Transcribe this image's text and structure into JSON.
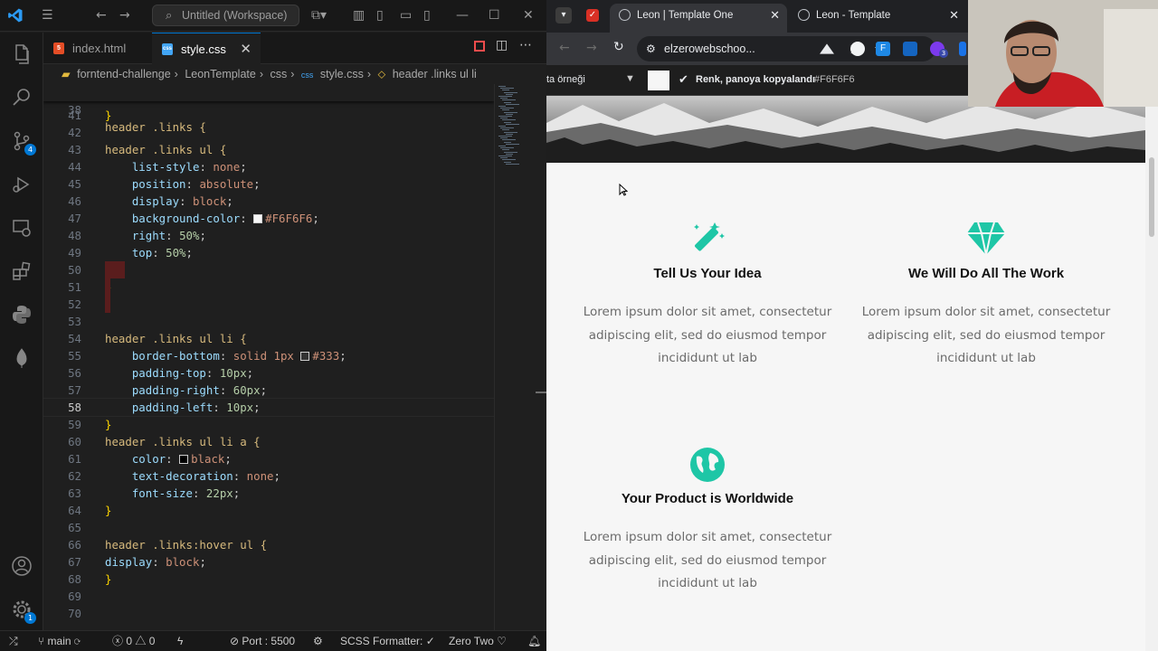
{
  "vscode": {
    "search_text": "Untitled (Workspace)",
    "tabs": [
      {
        "label": "index.html",
        "type": "html"
      },
      {
        "label": "style.css",
        "type": "css"
      }
    ],
    "breadcrumb": [
      "forntend-challenge",
      "LeonTemplate",
      "css",
      "style.css",
      "header .links ul li"
    ],
    "sticky_line": {
      "num": "38",
      "text": "header .links {"
    },
    "badges": {
      "source_control": "4",
      "accounts": "1"
    },
    "lines": [
      {
        "num": "41",
        "text": "}"
      },
      {
        "num": "42",
        "text": ""
      },
      {
        "num": "43",
        "text": "header .links ul {"
      },
      {
        "num": "44",
        "text": "    list-style: none;"
      },
      {
        "num": "45",
        "text": "    position: absolute;"
      },
      {
        "num": "46",
        "text": "    display: block;"
      },
      {
        "num": "47",
        "text": "    background-color: #F6F6F6;"
      },
      {
        "num": "48",
        "text": "    right: 50%;"
      },
      {
        "num": "49",
        "text": "    top: 50%;"
      },
      {
        "num": "50",
        "text": ""
      },
      {
        "num": "51",
        "text": "}"
      },
      {
        "num": "52",
        "text": ""
      },
      {
        "num": "53",
        "text": ""
      },
      {
        "num": "54",
        "text": "header .links ul li {"
      },
      {
        "num": "55",
        "text": "    border-bottom: solid 1px #333;"
      },
      {
        "num": "56",
        "text": "    padding-top: 10px;"
      },
      {
        "num": "57",
        "text": "    padding-right: 60px;"
      },
      {
        "num": "58",
        "text": "    padding-left: 10px;"
      },
      {
        "num": "59",
        "text": "}"
      },
      {
        "num": "60",
        "text": "header .links ul li a {"
      },
      {
        "num": "61",
        "text": "    color: black;"
      },
      {
        "num": "62",
        "text": "    text-decoration: none;"
      },
      {
        "num": "63",
        "text": "    font-size: 22px;"
      },
      {
        "num": "64",
        "text": "}"
      },
      {
        "num": "65",
        "text": ""
      },
      {
        "num": "66",
        "text": "header .links:hover ul {"
      },
      {
        "num": "67",
        "text": "display: block;"
      },
      {
        "num": "68",
        "text": "}"
      },
      {
        "num": "69",
        "text": ""
      },
      {
        "num": "70",
        "text": ""
      }
    ],
    "current_line": "58",
    "status": {
      "branch": "main",
      "errors": "0",
      "warnings": "0",
      "port": "Port : 5500",
      "formatter": "SCSS Formatter: ✓",
      "zero_two": "Zero Two"
    }
  },
  "browser": {
    "tabs": [
      {
        "label": "Leon | Template One",
        "active": true
      },
      {
        "label": "Leon - Template",
        "active": false
      }
    ],
    "url": "elzerowebschoo...",
    "devbar": {
      "left_text": "ta örneği",
      "toast": "Renk, panoya kopyalandı",
      "color_value": "#F6F6F6"
    },
    "extension_badge": "3",
    "features": [
      {
        "icon": "magic-wand-icon",
        "title": "Tell Us Your Idea",
        "text": "Lorem ipsum dolor sit amet, consectetur adipiscing elit, sed do eiusmod tempor incididunt ut lab"
      },
      {
        "icon": "gem-icon",
        "title": "We Will Do All The Work",
        "text": "Lorem ipsum dolor sit amet, consectetur adipiscing elit, sed do eiusmod tempor incididunt ut lab"
      },
      {
        "icon": "globe-icon",
        "title": "Your Product is Worldwide",
        "text": "Lorem ipsum dolor sit amet, consectetur adipiscing elit, sed do eiusmod tempor incididunt ut lab"
      }
    ]
  },
  "colors": {
    "accent": "#0078d4",
    "teal": "#1ec6a6",
    "page_bg": "#f6f6f6"
  }
}
